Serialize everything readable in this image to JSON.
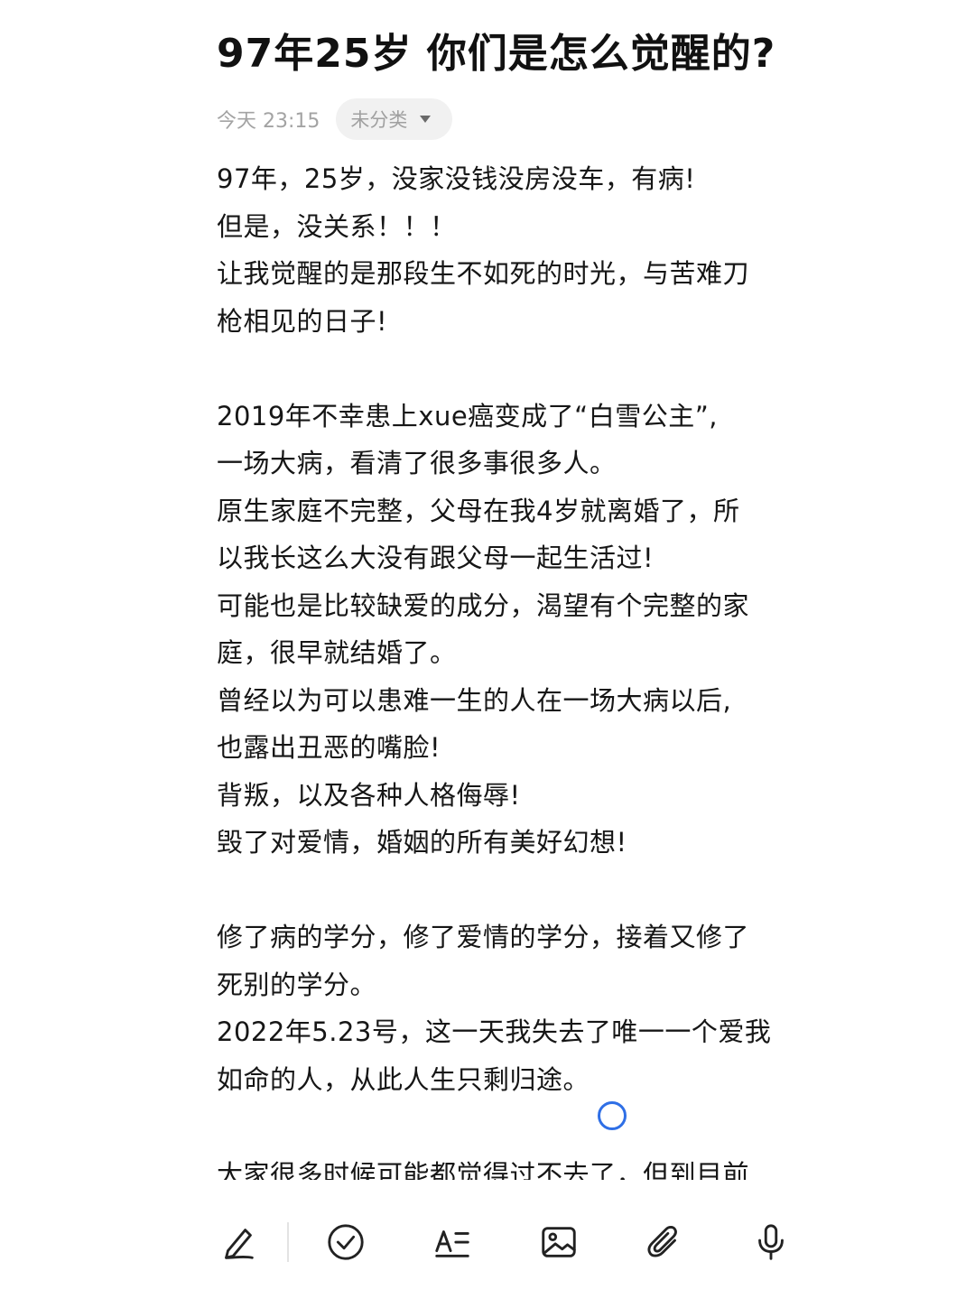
{
  "note": {
    "title": "97年25岁 你们是怎么觉醒的?",
    "time": "今天 23:15",
    "category": "未分类",
    "lines": [
      "97年，25岁，没家没钱没房没车，有病!",
      "但是，没关系！！！",
      "让我觉醒的是那段生不如死的时光，与苦难刀",
      "枪相见的日子!",
      "",
      "2019年不幸患上xue癌变成了“白雪公主”,",
      "一场大病，看清了很多事很多人。",
      "原生家庭不完整，父母在我4岁就离婚了，所",
      "以我长这么大没有跟父母一起生活过!",
      "可能也是比较缺爱的成分，渴望有个完整的家",
      "庭，很早就结婚了。",
      "曾经以为可以患难一生的人在一场大病以后,",
      "也露出丑恶的嘴脸!",
      "背叛，以及各种人格侮辱!",
      "毁了对爱情，婚姻的所有美好幻想!",
      "",
      "修了病的学分，修了爱情的学分，接着又修了",
      "死别的学分。",
      "2022年5.23号，这一天我失去了唯一一个爱我",
      "如命的人，从此人生只剩归途。",
      "",
      "大家很多时候可能都觉得过不去了，但到目前"
    ]
  },
  "toolbar": {
    "icons": [
      "handwriting-pen-icon",
      "checklist-icon",
      "text-format-icon",
      "image-icon",
      "attachment-icon",
      "microphone-icon"
    ]
  }
}
